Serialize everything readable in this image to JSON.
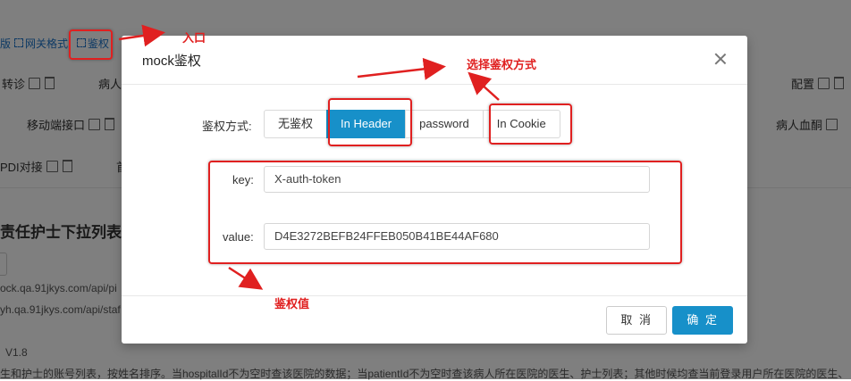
{
  "background": {
    "nav_partial": "版",
    "nav_gateway": "网关格式",
    "nav_auth": "鉴权",
    "row1": [
      "转诊",
      "病人",
      "配置"
    ],
    "row2": [
      "移动端接口",
      "病人血酮"
    ],
    "row3": [
      "PDI对接",
      "首"
    ],
    "heading_partial": "责任护士下拉列表(",
    "url1_partial": "ock.qa.91jkys.com/api/pi",
    "url2_partial": "yh.qa.91jkys.com/api/staf",
    "version": "V1.8",
    "description_partial": "生和护士的账号列表，按姓名排序。当hospitalId不为空时查该医院的数据；当patientId不为空时查该病人所在医院的医生、护士列表；其他时候均查当前登录用户所在医院的医生、"
  },
  "modal": {
    "title": "mock鉴权",
    "auth_mode_label": "鉴权方式:",
    "auth_options": [
      "无鉴权",
      "In Header",
      "password",
      "In Cookie"
    ],
    "selected_option": "In Header",
    "key_label": "key:",
    "key_value": "X-auth-token",
    "value_label": "value:",
    "value_value": "D4E3272BEFB24FFEB050B41BE44AF680",
    "cancel_label": "取 消",
    "ok_label": "确 定"
  },
  "annotations": {
    "entry": "入口",
    "select_mode": "选择鉴权方式",
    "auth_value": "鉴权值",
    "color": "#e02020"
  },
  "colors": {
    "primary": "#1790c9",
    "overlay": "rgba(0,0,0,0.5)"
  }
}
